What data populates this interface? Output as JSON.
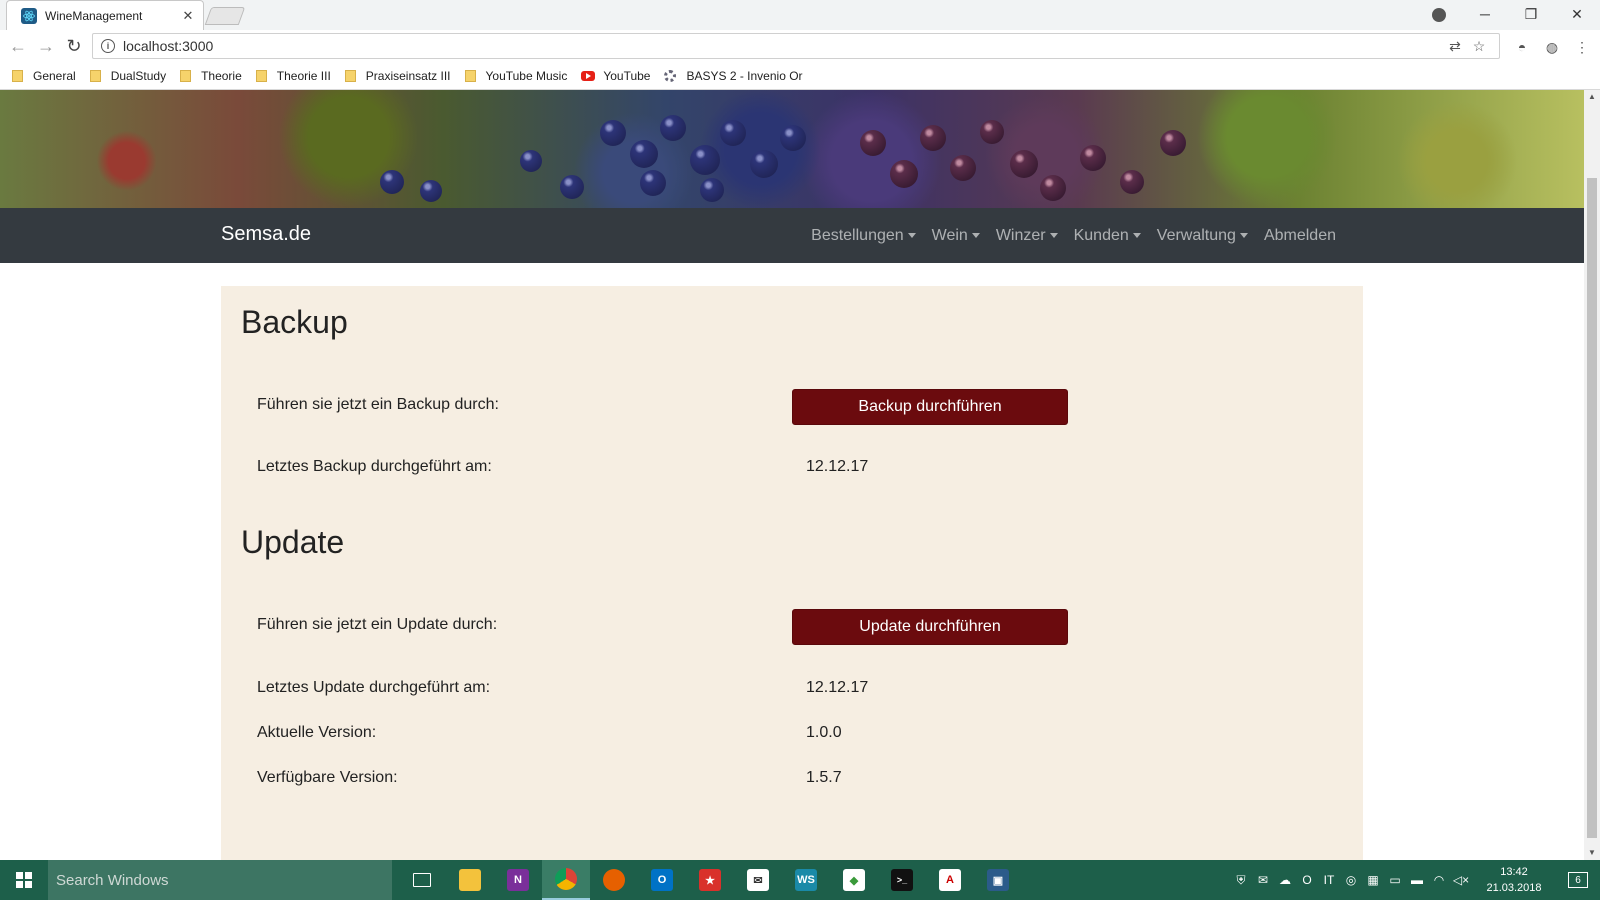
{
  "browser": {
    "tab_title": "WineManagement",
    "url": "localhost:3000",
    "bookmarks": [
      {
        "label": "General",
        "icon": "folder-icon"
      },
      {
        "label": "DualStudy",
        "icon": "folder-icon"
      },
      {
        "label": "Theorie",
        "icon": "folder-icon"
      },
      {
        "label": "Theorie III",
        "icon": "folder-icon"
      },
      {
        "label": "Praxiseinsatz III",
        "icon": "folder-icon"
      },
      {
        "label": "YouTube Music",
        "icon": "folder-icon"
      },
      {
        "label": "YouTube",
        "icon": "youtube-icon"
      },
      {
        "label": "BASYS 2 - Invenio Or",
        "icon": "basys-icon"
      }
    ]
  },
  "navbar": {
    "brand": "Semsa.de",
    "items": [
      {
        "label": "Bestellungen",
        "dropdown": true
      },
      {
        "label": "Wein",
        "dropdown": true
      },
      {
        "label": "Winzer",
        "dropdown": true
      },
      {
        "label": "Kunden",
        "dropdown": true
      },
      {
        "label": "Verwaltung",
        "dropdown": true
      },
      {
        "label": "Abmelden",
        "dropdown": false
      }
    ]
  },
  "backup": {
    "title": "Backup",
    "run_label": "Führen sie jetzt ein Backup durch:",
    "run_button": "Backup durchführen",
    "last_label": "Letztes Backup durchgeführt am:",
    "last_value": "12.12.17"
  },
  "update": {
    "title": "Update",
    "run_label": "Führen sie jetzt ein Update durch:",
    "run_button": "Update durchführen",
    "last_label": "Letztes Update durchgeführt am:",
    "last_value": "12.12.17",
    "current_label": "Aktuelle Version:",
    "current_value": "1.0.0",
    "available_label": "Verfügbare Version:",
    "available_value": "1.5.7"
  },
  "taskbar": {
    "search_placeholder": "Search Windows",
    "time": "13:42",
    "date": "21.03.2018",
    "notification_count": "6"
  },
  "colors": {
    "navbar_bg": "#343a40",
    "card_bg": "#f6eee2",
    "button_bg": "#6b0b0e",
    "taskbar_bg": "#1d5f4a"
  }
}
